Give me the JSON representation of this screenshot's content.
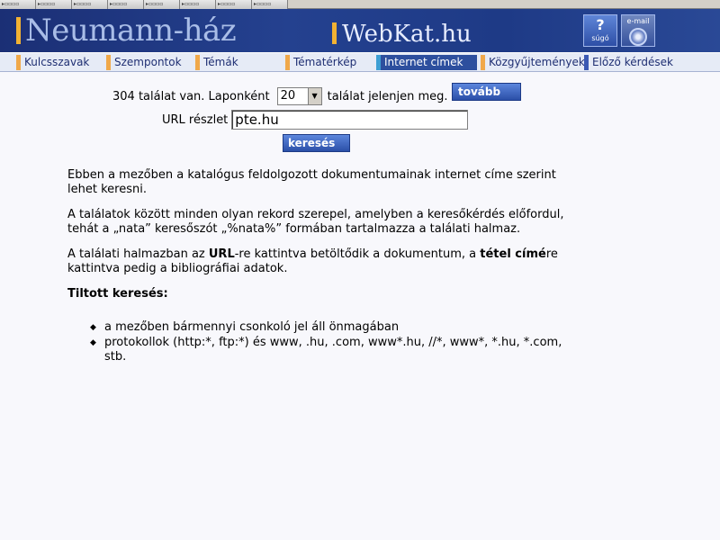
{
  "tabstrip": {
    "tabs": [
      "▸▫▫▫▫",
      "▸▫▫▫▫",
      "▸▫▫▫▫",
      "▸▫▫▫▫",
      "▸▫▫▫▫",
      "▸▫▫▫▫",
      "▸▫▫▫▫",
      "▸▫▫▫▫"
    ]
  },
  "banner": {
    "logo_left": "Neumann-ház",
    "logo_right": "WebKat.hu",
    "help_glyph": "?",
    "help_label": "súgó",
    "email_label": "e-mail"
  },
  "nav": {
    "items": [
      {
        "label": "Kulcsszavak",
        "active": false
      },
      {
        "label": "Szempontok",
        "active": false
      },
      {
        "label": "Témák",
        "active": false
      },
      {
        "label": "Tématérkép",
        "active": false
      },
      {
        "label": "Internet címek",
        "active": true
      },
      {
        "label": "Közgyűjtemények",
        "active": false
      },
      {
        "label": "Előző kérdések",
        "active": false
      }
    ]
  },
  "search": {
    "results_prefix": "304 találat van. Laponként",
    "per_page_value": "20",
    "results_suffix": "találat jelenjen meg.",
    "next_button": "tovább",
    "url_label": "URL részlet",
    "url_value": "pte.hu",
    "search_button": "keresés"
  },
  "help": {
    "para1": "Ebben a mezőben a katalógus feldolgozott dokumentumainak internet címe szerint lehet keresni.",
    "para2": "A találatok között minden olyan rekord szerepel, amelyben a keresőkérdés előfordul, tehát a „nata” keresőszót „%nata%” formában tartalmazza a találati halmaz.",
    "para3_a": "A találati halmazban az ",
    "para3_b": "URL",
    "para3_c": "-re kattintva betöltődik a dokumentum, a ",
    "para3_d": "tétel címé",
    "para3_e": "re kattintva pedig a bibliográfiai adatok.",
    "forbidden_title": "Tiltott keresés:",
    "forbidden_items": [
      "a mezőben bármennyi csonkoló jel áll önmagában",
      "protokollok (http:*, ftp:*) és www, .hu, .com, www*.hu, //*, www*, *.hu, *.com, stb."
    ]
  },
  "colors": {
    "banner_bg": "#1e3a86",
    "accent_orange": "#f2b233",
    "nav_active_bg": "#2d4f9e",
    "button_blue": "#2b4fa8"
  }
}
